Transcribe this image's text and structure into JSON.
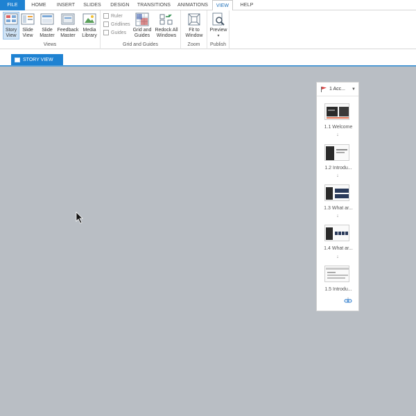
{
  "menu": {
    "tabs": [
      {
        "label": "FILE"
      },
      {
        "label": "HOME"
      },
      {
        "label": "INSERT"
      },
      {
        "label": "SLIDES"
      },
      {
        "label": "DESIGN"
      },
      {
        "label": "TRANSITIONS"
      },
      {
        "label": "ANIMATIONS"
      },
      {
        "label": "VIEW"
      },
      {
        "label": "HELP"
      }
    ],
    "active": "VIEW"
  },
  "ribbon": {
    "views": {
      "label": "Views",
      "story_view": "Story View",
      "slide_view": "Slide View",
      "slide_master": "Slide Master",
      "feedback_master": "Feedback Master",
      "media_library": "Media Library"
    },
    "grid": {
      "label": "Grid and Guides",
      "ruler": "Ruler",
      "gridlines": "Gridlines",
      "guides": "Guides",
      "grid_and_guides": "Grid and Guides",
      "redock": "Redock All Windows"
    },
    "zoom": {
      "label": "Zoom",
      "fit": "Fit to Window"
    },
    "publish": {
      "label": "Publish",
      "preview": "Preview"
    }
  },
  "story_tab": {
    "label": "STORY VIEW"
  },
  "scene": {
    "title": "1 Acc...",
    "slides": [
      {
        "label": "1.1 Welcome"
      },
      {
        "label": "1.2 Introdu..."
      },
      {
        "label": "1.3 What ar..."
      },
      {
        "label": "1.4 What ar..."
      },
      {
        "label": "1.5 Introdu..."
      }
    ]
  },
  "colors": {
    "accent": "#1e82d2",
    "canvas": "#b9bec4"
  }
}
